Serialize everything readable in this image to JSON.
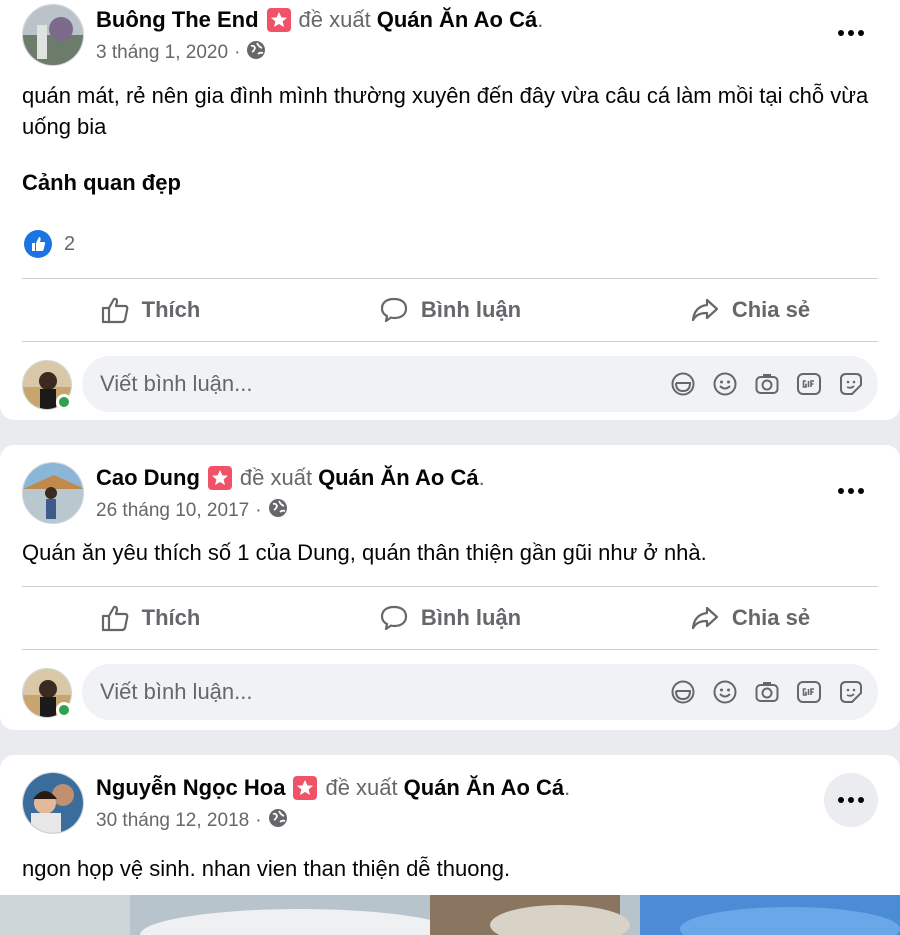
{
  "posts": [
    {
      "author": "Buông The End",
      "recommends": "đề xuất",
      "page": "Quán Ăn Ao Cá",
      "dot": ".",
      "date": "3 tháng 1, 2020",
      "sep": "·",
      "text": "quán mát, rẻ nên gia đình mình thường xuyên đến đây vừa câu cá làm mồi tại chỗ vừa uống bia",
      "tag": "Cảnh quan đẹp",
      "like_count": "2"
    },
    {
      "author": "Cao Dung",
      "recommends": "đề xuất",
      "page": "Quán Ăn Ao Cá",
      "dot": ".",
      "date": "26 tháng 10, 2017",
      "sep": "·",
      "text": "Quán ăn yêu thích số 1 của Dung, quán thân thiện gần gũi như ở nhà."
    },
    {
      "author": "Nguyễn Ngọc Hoa",
      "recommends": "đề xuất",
      "page": "Quán Ăn Ao Cá",
      "dot": ".",
      "date": "30 tháng 12, 2018",
      "sep": "·",
      "text": "ngon họp vệ sinh. nhan vien than thiện dễ thuong."
    }
  ],
  "actions": {
    "like": "Thích",
    "comment": "Bình luận",
    "share": "Chia sẻ"
  },
  "composer": {
    "placeholder": "Viết bình luận..."
  },
  "colors": {
    "accent": "#1b74e4",
    "badge": "#f25268",
    "online": "#31a24c"
  }
}
